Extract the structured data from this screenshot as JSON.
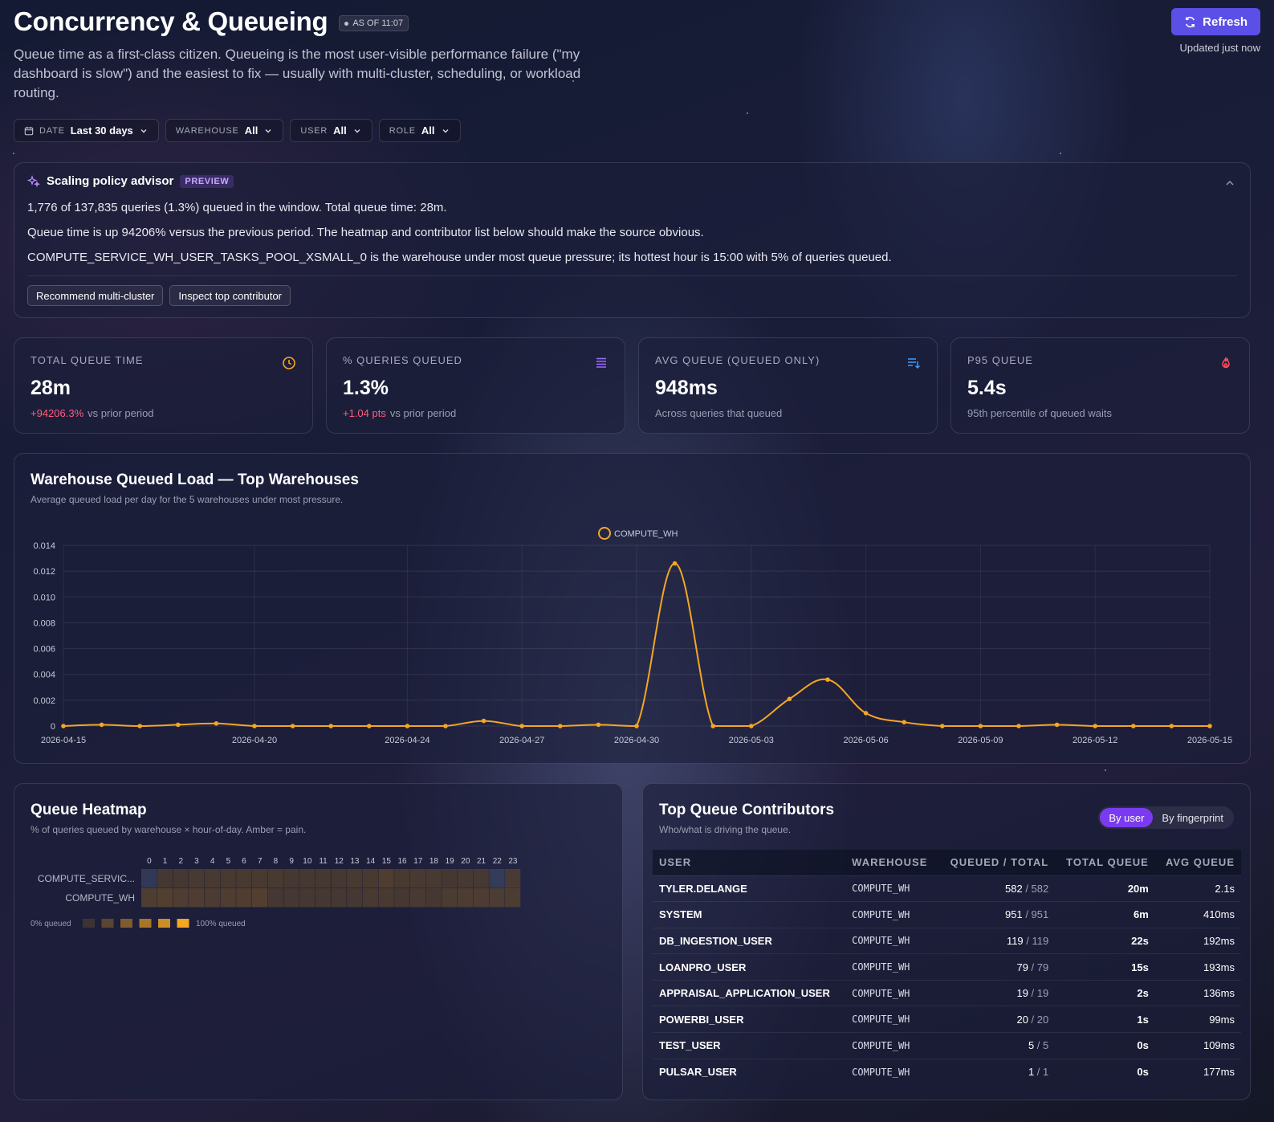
{
  "header": {
    "title": "Concurrency & Queueing",
    "as_of": "AS OF 11:07",
    "subtitle": "Queue time as a first-class citizen. Queueing is the most user-visible performance failure (\"my dashboard is slow\") and the easiest to fix — usually with multi-cluster, scheduling, or workload routing.",
    "refresh_label": "Refresh",
    "updated_text": "Updated just now"
  },
  "filters": [
    {
      "label": "DATE",
      "value": "Last 30 days"
    },
    {
      "label": "WAREHOUSE",
      "value": "All"
    },
    {
      "label": "USER",
      "value": "All"
    },
    {
      "label": "ROLE",
      "value": "All"
    }
  ],
  "advisor": {
    "title": "Scaling policy advisor",
    "badge": "PREVIEW",
    "lines": [
      "1,776 of 137,835 queries (1.3%) queued in the window. Total queue time: 28m.",
      "Queue time is up 94206% versus the previous period. The heatmap and contributor list below should make the source obvious.",
      "COMPUTE_SERVICE_WH_USER_TASKS_POOL_XSMALL_0 is the warehouse under most queue pressure; its hottest hour is 15:00 with 5% of queries queued."
    ],
    "actions": [
      "Recommend multi-cluster",
      "Inspect top contributor"
    ]
  },
  "kpis": [
    {
      "label": "TOTAL QUEUE TIME",
      "value": "28m",
      "delta": "+94206.3%",
      "note": "vs prior period",
      "icon": "clock-icon",
      "icon_color": "#f5a623"
    },
    {
      "label": "% QUERIES QUEUED",
      "value": "1.3%",
      "delta": "+1.04 pts",
      "note": "vs prior period",
      "icon": "list-stack-icon",
      "icon_color": "#9b6bff"
    },
    {
      "label": "AVG QUEUE (QUEUED ONLY)",
      "value": "948ms",
      "delta": "",
      "note": "Across queries that queued",
      "icon": "sort-list-icon",
      "icon_color": "#3b9dff"
    },
    {
      "label": "P95 QUEUE",
      "value": "5.4s",
      "delta": "",
      "note": "95th percentile of queued waits",
      "icon": "flame-icon",
      "icon_color": "#ff4d5e"
    }
  ],
  "line_card": {
    "title": "Warehouse Queued Load — Top Warehouses",
    "subtitle": "Average queued load per day for the 5 warehouses under most pressure."
  },
  "heat_card": {
    "title": "Queue Heatmap",
    "subtitle": "% of queries queued by warehouse × hour-of-day. Amber = pain.",
    "legend_min": "0% queued",
    "legend_max": "100% queued"
  },
  "contrib_card": {
    "title": "Top Queue Contributors",
    "subtitle": "Who/what is driving the queue.",
    "tabs": [
      "By user",
      "By fingerprint"
    ],
    "active_tab": "By user",
    "columns": [
      "USER",
      "WAREHOUSE",
      "QUEUED / TOTAL",
      "TOTAL QUEUE",
      "AVG QUEUE"
    ],
    "rows": [
      {
        "user": "TYLER.DELANGE",
        "warehouse": "COMPUTE_WH",
        "queued": "582",
        "total": "582",
        "total_queue": "20m",
        "avg_queue": "2.1s"
      },
      {
        "user": "SYSTEM",
        "warehouse": "COMPUTE_WH",
        "queued": "951",
        "total": "951",
        "total_queue": "6m",
        "avg_queue": "410ms"
      },
      {
        "user": "DB_INGESTION_USER",
        "warehouse": "COMPUTE_WH",
        "queued": "119",
        "total": "119",
        "total_queue": "22s",
        "avg_queue": "192ms"
      },
      {
        "user": "LOANPRO_USER",
        "warehouse": "COMPUTE_WH",
        "queued": "79",
        "total": "79",
        "total_queue": "15s",
        "avg_queue": "193ms"
      },
      {
        "user": "APPRAISAL_APPLICATION_USER",
        "warehouse": "COMPUTE_WH",
        "queued": "19",
        "total": "19",
        "total_queue": "2s",
        "avg_queue": "136ms"
      },
      {
        "user": "POWERBI_USER",
        "warehouse": "COMPUTE_WH",
        "queued": "20",
        "total": "20",
        "total_queue": "1s",
        "avg_queue": "99ms"
      },
      {
        "user": "TEST_USER",
        "warehouse": "COMPUTE_WH",
        "queued": "5",
        "total": "5",
        "total_queue": "0s",
        "avg_queue": "109ms"
      },
      {
        "user": "PULSAR_USER",
        "warehouse": "COMPUTE_WH",
        "queued": "1",
        "total": "1",
        "total_queue": "0s",
        "avg_queue": "177ms"
      }
    ]
  },
  "chart_data": [
    {
      "type": "line",
      "title": "Warehouse Queued Load — Top Warehouses",
      "xlabel": "",
      "ylabel": "",
      "ylim": [
        0,
        0.014
      ],
      "yticks": [
        0,
        0.002,
        0.004,
        0.006,
        0.008,
        0.01,
        0.012,
        0.014
      ],
      "ytick_labels": [
        "0",
        "0.002",
        "0.004",
        "0.006",
        "0.008",
        "0.010",
        "0.012",
        "0.014"
      ],
      "xtick_labels": [
        "2026-04-15",
        "2026-04-20",
        "2026-04-24",
        "2026-04-27",
        "2026-04-30",
        "2026-05-03",
        "2026-05-06",
        "2026-05-09",
        "2026-05-12",
        "2026-05-15"
      ],
      "grid": true,
      "legend_position": "top-center",
      "color": "#f5a623",
      "x": [
        "2026-04-15",
        "2026-04-16",
        "2026-04-17",
        "2026-04-18",
        "2026-04-19",
        "2026-04-20",
        "2026-04-21",
        "2026-04-22",
        "2026-04-23",
        "2026-04-24",
        "2026-04-25",
        "2026-04-26",
        "2026-04-27",
        "2026-04-28",
        "2026-04-29",
        "2026-04-30",
        "2026-05-01",
        "2026-05-02",
        "2026-05-03",
        "2026-05-04",
        "2026-05-05",
        "2026-05-06",
        "2026-05-07",
        "2026-05-08",
        "2026-05-09",
        "2026-05-10",
        "2026-05-11",
        "2026-05-12",
        "2026-05-13",
        "2026-05-14",
        "2026-05-15"
      ],
      "series": [
        {
          "name": "COMPUTE_WH",
          "values": [
            0,
            0.0001,
            0,
            0.0001,
            0.0002,
            0,
            0,
            0,
            0,
            0,
            0,
            0.0004,
            0,
            0,
            0.0001,
            0,
            0.0126,
            0,
            0,
            0.0021,
            0.0036,
            0.001,
            0.0003,
            0,
            0,
            0,
            0.0001,
            0,
            0,
            0,
            0
          ]
        }
      ]
    },
    {
      "type": "heatmap",
      "title": "Queue Heatmap",
      "x_categories": [
        "0",
        "1",
        "2",
        "3",
        "4",
        "5",
        "6",
        "7",
        "8",
        "9",
        "10",
        "11",
        "12",
        "13",
        "14",
        "15",
        "16",
        "17",
        "18",
        "19",
        "20",
        "21",
        "22",
        "23"
      ],
      "y_categories": [
        "COMPUTE_SERVIC...",
        "COMPUTE_WH"
      ],
      "color_scale": [
        "#4a3b30",
        "#f5a623"
      ],
      "values": [
        [
          0.0,
          0.02,
          0.02,
          0.03,
          0.03,
          0.03,
          0.03,
          0.03,
          0.03,
          0.02,
          0.02,
          0.02,
          0.02,
          0.03,
          0.03,
          0.05,
          0.03,
          0.03,
          0.03,
          0.02,
          0.02,
          0.02,
          0.0,
          0.03
        ],
        [
          0.05,
          0.06,
          0.05,
          0.05,
          0.04,
          0.05,
          0.05,
          0.06,
          0.02,
          0.02,
          0.02,
          0.02,
          0.02,
          0.02,
          0.03,
          0.03,
          0.02,
          0.03,
          0.02,
          0.04,
          0.04,
          0.04,
          0.04,
          0.04
        ]
      ]
    }
  ]
}
